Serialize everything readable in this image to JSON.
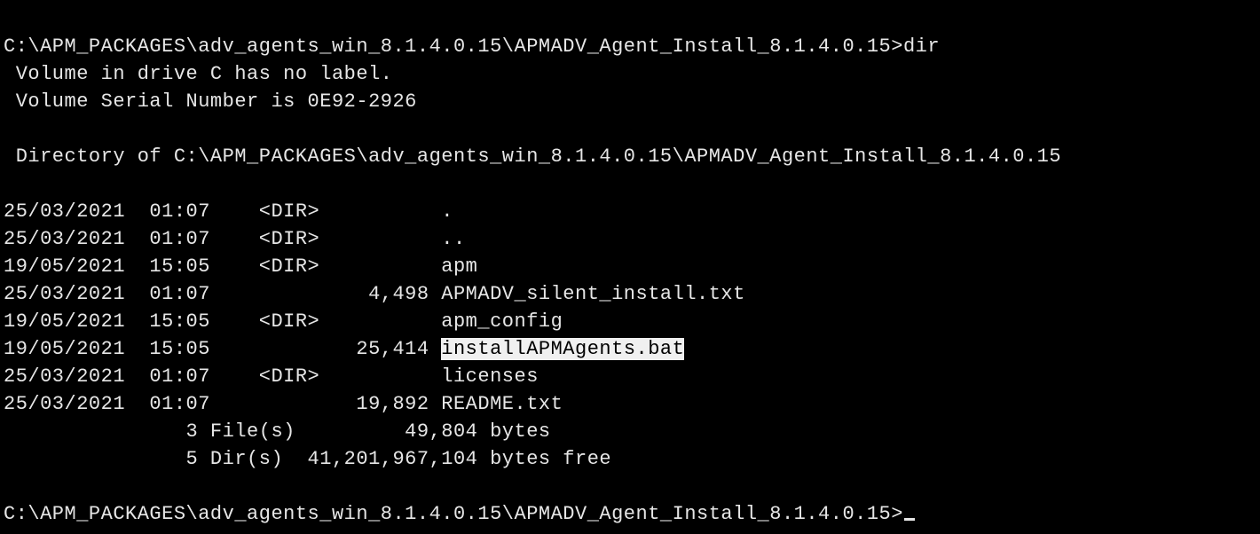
{
  "prompt1_path": "C:\\APM_PACKAGES\\adv_agents_win_8.1.4.0.15\\APMADV_Agent_Install_8.1.4.0.15>",
  "command": "dir",
  "vol_line1": " Volume in drive C has no label.",
  "vol_line2": " Volume Serial Number is 0E92-2926",
  "dir_of": " Directory of C:\\APM_PACKAGES\\adv_agents_win_8.1.4.0.15\\APMADV_Agent_Install_8.1.4.0.15",
  "rows": {
    "r1": "25/03/2021  01:07    <DIR>          .",
    "r2": "25/03/2021  01:07    <DIR>          ..",
    "r3": "19/05/2021  15:05    <DIR>          apm",
    "r4": "25/03/2021  01:07             4,498 APMADV_silent_install.txt",
    "r5": "19/05/2021  15:05    <DIR>          apm_config",
    "r6_pre": "19/05/2021  15:05            25,414 ",
    "r6_hl": "installAPMAgents.bat",
    "r7": "25/03/2021  01:07    <DIR>          licenses",
    "r8": "25/03/2021  01:07            19,892 README.txt"
  },
  "summary1": "               3 File(s)         49,804 bytes",
  "summary2": "               5 Dir(s)  41,201,967,104 bytes free",
  "prompt2_path": "C:\\APM_PACKAGES\\adv_agents_win_8.1.4.0.15\\APMADV_Agent_Install_8.1.4.0.15>"
}
